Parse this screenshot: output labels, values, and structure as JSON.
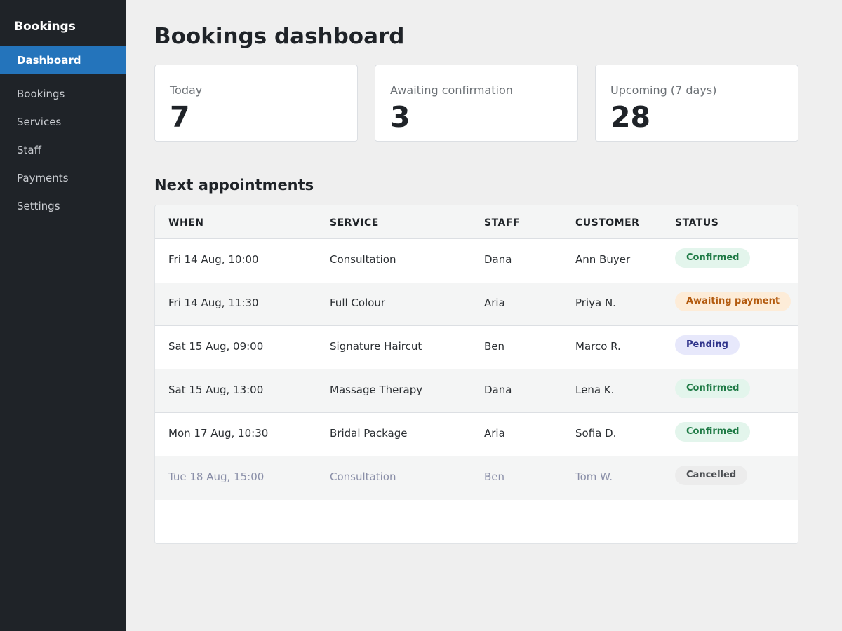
{
  "sidebar": {
    "brand": "Bookings",
    "items": [
      {
        "label": "Dashboard",
        "active": true
      },
      {
        "label": "Bookings"
      },
      {
        "label": "Services"
      },
      {
        "label": "Staff"
      },
      {
        "label": "Payments"
      },
      {
        "label": "Settings"
      }
    ]
  },
  "main": {
    "title": "Bookings dashboard",
    "stats": [
      {
        "label": "Today",
        "value": "7"
      },
      {
        "label": "Awaiting confirmation",
        "value": "3"
      },
      {
        "label": "Upcoming (7 days)",
        "value": "28"
      }
    ],
    "section_title": "Next appointments",
    "table": {
      "headers": [
        "WHEN",
        "SERVICE",
        "STAFF",
        "CUSTOMER",
        "STATUS"
      ],
      "rows": [
        {
          "when": "Fri 14 Aug, 10:00",
          "service": "Consultation",
          "staff": "Dana",
          "customer": "Ann Buyer",
          "status": "Confirmed"
        },
        {
          "when": "Fri 14 Aug, 11:30",
          "service": "Full Colour",
          "staff": "Aria",
          "customer": "Priya N.",
          "status": "Awaiting payment"
        },
        {
          "when": "Sat 15 Aug, 09:00",
          "service": "Signature Haircut",
          "staff": "Ben",
          "customer": "Marco R.",
          "status": "Pending"
        },
        {
          "when": "Sat 15 Aug, 13:00",
          "service": "Massage Therapy",
          "staff": "Dana",
          "customer": "Lena K.",
          "status": "Confirmed"
        },
        {
          "when": "Mon 17 Aug, 10:30",
          "service": "Bridal Package",
          "staff": "Aria",
          "customer": "Sofia D.",
          "status": "Confirmed"
        },
        {
          "when": "Tue 18 Aug, 15:00",
          "service": "Consultation",
          "staff": "Ben",
          "customer": "Tom W.",
          "status": "Cancelled"
        }
      ]
    }
  },
  "colors": {
    "sidebar_bg": "#1f2328",
    "accent": "#2474bb",
    "confirmed": "#1e7a45",
    "awaiting": "#b35a0e",
    "pending": "#2e328a",
    "cancelled": "#4a4d51"
  }
}
